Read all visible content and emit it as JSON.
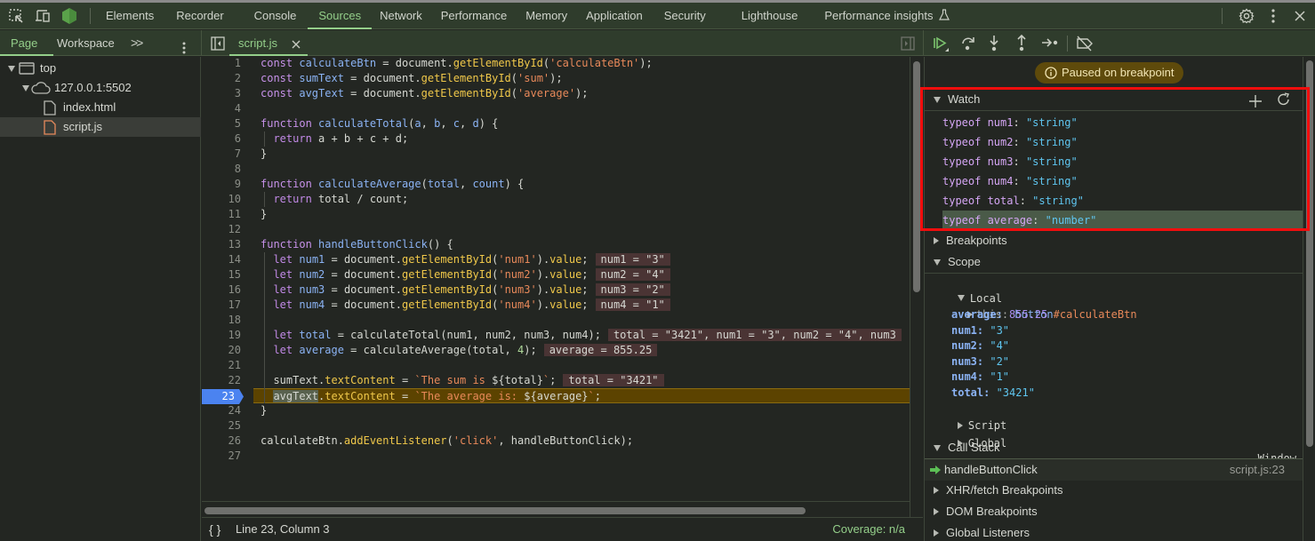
{
  "main_toolbar": {
    "icons": [
      "inspect-element-icon",
      "device-toolbar-icon",
      "node-icon"
    ],
    "tabs": [
      {
        "label": "Elements",
        "active": false
      },
      {
        "label": "Recorder",
        "active": false
      },
      {
        "label": "Console",
        "active": false
      },
      {
        "label": "Sources",
        "active": true
      },
      {
        "label": "Network",
        "active": false
      },
      {
        "label": "Performance",
        "active": false
      },
      {
        "label": "Memory",
        "active": false
      },
      {
        "label": "Application",
        "active": false
      },
      {
        "label": "Security",
        "active": false
      },
      {
        "label": "Lighthouse",
        "active": false
      },
      {
        "label": "Performance insights",
        "active": false
      }
    ],
    "right_icons": [
      "gear-icon",
      "more-vertical-icon",
      "close-icon"
    ]
  },
  "navigator": {
    "tabs": [
      {
        "label": "Page",
        "active": true
      },
      {
        "label": "Workspace",
        "active": false
      }
    ],
    "more_label": ">>",
    "tree": [
      {
        "label": "top",
        "type": "frame",
        "expanded": true
      },
      {
        "label": "127.0.0.1:5502",
        "type": "origin",
        "expanded": true
      },
      {
        "label": "index.html",
        "type": "file"
      },
      {
        "label": "script.js",
        "type": "file",
        "selected": true
      }
    ]
  },
  "editor": {
    "open_tab": "script.js",
    "breakpoint_line": 23,
    "lines": [
      {
        "n": "1"
      },
      {
        "n": "2"
      },
      {
        "n": "3"
      },
      {
        "n": "4"
      },
      {
        "n": "5"
      },
      {
        "n": "6"
      },
      {
        "n": "7"
      },
      {
        "n": "8"
      },
      {
        "n": "9"
      },
      {
        "n": "10"
      },
      {
        "n": "11"
      },
      {
        "n": "12"
      },
      {
        "n": "13"
      },
      {
        "n": "14"
      },
      {
        "n": "15"
      },
      {
        "n": "16"
      },
      {
        "n": "17"
      },
      {
        "n": "18"
      },
      {
        "n": "19"
      },
      {
        "n": "20"
      },
      {
        "n": "21"
      },
      {
        "n": "22"
      },
      {
        "n": "23"
      },
      {
        "n": "24"
      },
      {
        "n": "25"
      },
      {
        "n": "26"
      },
      {
        "n": "27"
      }
    ],
    "code": {
      "l1": [
        "const",
        " calculateBtn",
        " = document.",
        "getElementById",
        "(",
        "'calculateBtn'",
        ");"
      ],
      "l2": [
        "const",
        " sumText",
        " = document.",
        "getElementById",
        "(",
        "'sum'",
        ");"
      ],
      "l3": [
        "const",
        " avgText",
        " = document.",
        "getElementById",
        "(",
        "'average'",
        ");"
      ],
      "l5": [
        "function",
        " calculateTotal",
        "(",
        "a",
        ", ",
        "b",
        ", ",
        "c",
        ", ",
        "d",
        ") {"
      ],
      "l6": [
        "return",
        " a + b + c + d;"
      ],
      "l7": "}",
      "l9": [
        "function",
        " calculateAverage",
        "(",
        "total",
        ", ",
        "count",
        ") {"
      ],
      "l10": [
        "return",
        " total / count;"
      ],
      "l11": "}",
      "l13": [
        "function",
        " handleButtonClick",
        "() {"
      ],
      "l14": [
        "let",
        " num1",
        " = document.",
        "getElementById",
        "(",
        "'num1'",
        ").",
        "value",
        ";"
      ],
      "l15": [
        "let",
        " num2",
        " = document.",
        "getElementById",
        "(",
        "'num2'",
        ").",
        "value",
        ";"
      ],
      "l16": [
        "let",
        " num3",
        " = document.",
        "getElementById",
        "(",
        "'num3'",
        ").",
        "value",
        ";"
      ],
      "l17": [
        "let",
        " num4",
        " = document.",
        "getElementById",
        "(",
        "'num4'",
        ").",
        "value",
        ";"
      ],
      "l19": [
        "let",
        " total",
        " = calculateTotal(num1, num2, num3, num4);"
      ],
      "l20": [
        "let",
        " average",
        " = calculateAverage(total, ",
        "4",
        ");"
      ],
      "l22": [
        "sumText.",
        "textContent",
        " = ",
        "`The sum is ",
        "${total}",
        "`",
        ";"
      ],
      "l23": [
        "avgText",
        ".",
        "textContent",
        " = ",
        "`The average is: ",
        "${average}",
        "`",
        ";"
      ],
      "l24": "}",
      "l26": [
        "calculateBtn.",
        "addEventListener",
        "(",
        "'click'",
        ", handleButtonClick);"
      ]
    },
    "inline_values": {
      "l14": "num1 = \"3\"",
      "l15": "num2 = \"4\"",
      "l16": "num3 = \"2\"",
      "l17": "num4 = \"1\"",
      "l19": "total = \"3421\", num1 = \"3\", num2 = \"4\", num3",
      "l20": "average = 855.25",
      "l22": "total = \"3421\""
    }
  },
  "status_bar": {
    "format_icon": "{ }",
    "position": "Line 23, Column 3",
    "coverage": "Coverage: n/a"
  },
  "debugger": {
    "toolbar_icons": [
      "resume-icon",
      "step-over-icon",
      "step-into-icon",
      "step-out-icon",
      "step-icon",
      "deactivate-breakpoints-icon"
    ],
    "paused_message": "Paused on breakpoint",
    "watch": {
      "title": "Watch",
      "items": [
        {
          "expr": "typeof num1",
          "value": "\"string\""
        },
        {
          "expr": "typeof num2",
          "value": "\"string\""
        },
        {
          "expr": "typeof num3",
          "value": "\"string\""
        },
        {
          "expr": "typeof num4",
          "value": "\"string\""
        },
        {
          "expr": "typeof total",
          "value": "\"string\""
        },
        {
          "expr": "typeof average",
          "value": "\"number\"",
          "highlighted": true
        }
      ]
    },
    "breakpoints_title": "Breakpoints",
    "scope": {
      "title": "Scope",
      "local_title": "Local",
      "this_key": "this",
      "this_value_tag": "button",
      "this_value_id": "#calculateBtn",
      "vars": [
        {
          "key": "average",
          "value": "855.25",
          "type": "number"
        },
        {
          "key": "num1",
          "value": "\"3\"",
          "type": "string"
        },
        {
          "key": "num2",
          "value": "\"4\"",
          "type": "string"
        },
        {
          "key": "num3",
          "value": "\"2\"",
          "type": "string"
        },
        {
          "key": "num4",
          "value": "\"1\"",
          "type": "string"
        },
        {
          "key": "total",
          "value": "\"3421\"",
          "type": "string"
        }
      ],
      "script_title": "Script",
      "global_title": "Global",
      "global_value": "Window"
    },
    "call_stack": {
      "title": "Call Stack",
      "frames": [
        {
          "name": "handleButtonClick",
          "location": "script.js:23"
        }
      ]
    },
    "xhr_title": "XHR/fetch Breakpoints",
    "dom_title": "DOM Breakpoints",
    "listeners_title": "Global Listeners"
  },
  "colors": {
    "accent": "#94cf8a",
    "breakpoint": "#4b83f0",
    "paused_bg": "#5e4a0b",
    "annotation_red": "#f20d0d"
  }
}
